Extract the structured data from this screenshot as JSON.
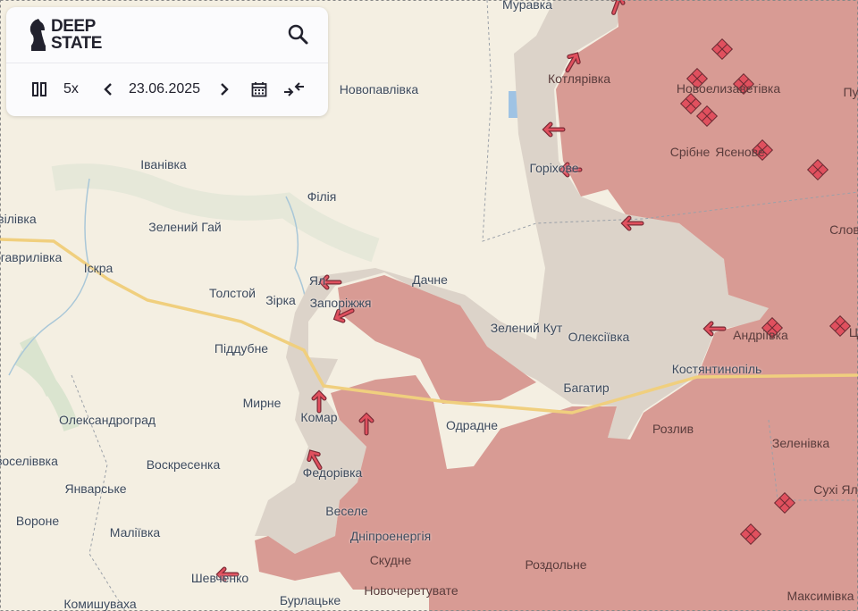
{
  "app": {
    "logo_line1": "DEEP",
    "logo_line2": "STATE"
  },
  "controls": {
    "speed": "5x",
    "date": "23.06.2025",
    "icons": [
      "pause-icon",
      "chevron-left-icon",
      "chevron-right-icon",
      "calendar-icon",
      "collapse-icon",
      "search-icon"
    ]
  },
  "colors": {
    "occupied": "#d89b94",
    "contested": "#dcd3c9",
    "road": "#f0cf7e",
    "marker": "#e0505e",
    "land": "#f4efe2"
  },
  "map": {
    "labels": [
      "Муравка",
      "Новопавлівка",
      "Котлярівка",
      "Новоелизаветівка",
      "Пу",
      "Срібне",
      "Ясенове",
      "Горіхове",
      "Іванівка",
      "Філія",
      "Зелений Гай",
      "Слов",
      "ивілівка",
      "гаврилівка",
      "Іскра",
      "Толстой",
      "Зірка",
      "Дачне",
      "Ял",
      "Запоріжжя",
      "Зелений Кут",
      "Олексіївка",
      "Андріївка",
      "Ц",
      "Піддубне",
      "Костянтинопіль",
      "Багатир",
      "Мирне",
      "Комар",
      "Олександроград",
      "Одрадне",
      "Розлив",
      "Зеленівка",
      "воселіввка",
      "Воскресенка",
      "Федорівка",
      "Сухі Ял",
      "Январське",
      "Веселе",
      "Вороне",
      "Дніпроенергія",
      "Маліївка",
      "Скудне",
      "Роздольне",
      "Шевченко",
      "Комишуваха",
      "Бурлацьке",
      "Новочеретувате",
      "Максимівка"
    ]
  }
}
